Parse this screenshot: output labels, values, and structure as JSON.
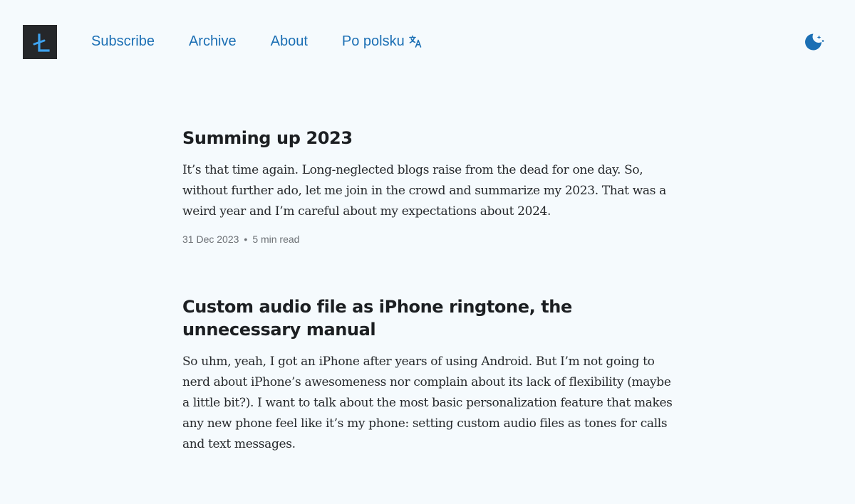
{
  "nav": {
    "items": [
      {
        "label": "Subscribe"
      },
      {
        "label": "Archive"
      },
      {
        "label": "About"
      },
      {
        "label": "Po polsku"
      }
    ]
  },
  "icons": {
    "logo": "logo-icon",
    "translate": "translate-icon",
    "theme": "moon-icon"
  },
  "colors": {
    "background": "#f5fafd",
    "link": "#1b6fb4",
    "logo_bg": "#25272a",
    "logo_glyph": "#3ea2ee",
    "text": "#1c1f22",
    "meta": "#6c7075"
  },
  "posts": [
    {
      "title": "Summing up 2023",
      "excerpt": "It’s that time again. Long-neglected blogs raise from the dead for one day. So, without further ado, let me join in the crowd and summarize my 2023. That was a weird year and I’m careful about my expectations about 2024.",
      "date": "31 Dec 2023",
      "separator": "•",
      "read_time": "5 min read"
    },
    {
      "title": "Custom audio file as iPhone ringtone, the unnecessary manual",
      "excerpt": "So uhm, yeah, I got an iPhone after years of using Android. But I’m not going to nerd about iPhone’s awesomeness nor complain about its lack of flexibility (maybe a little bit?). I want to talk about the most basic personalization feature that makes any new phone feel like it’s my phone: setting custom audio files as tones for calls and text messages."
    }
  ]
}
